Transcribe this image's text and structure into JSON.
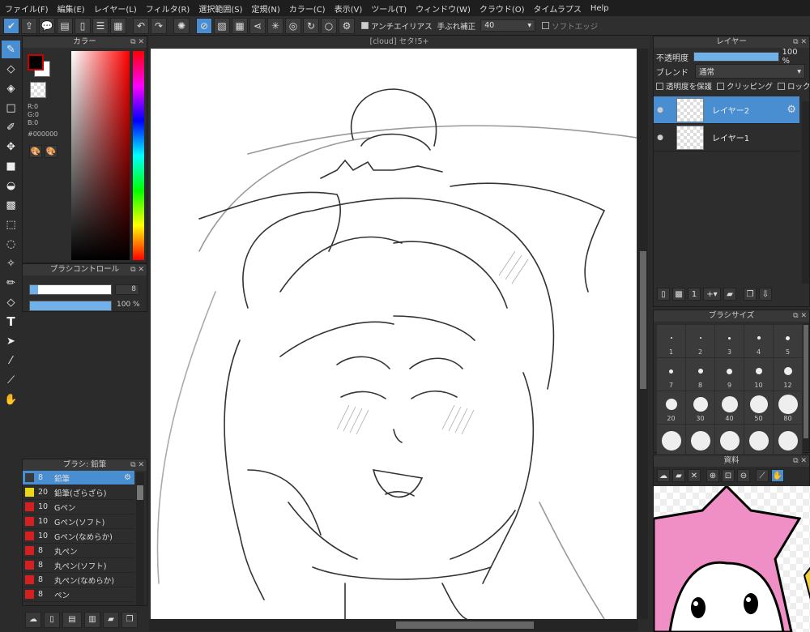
{
  "menu": [
    "ファイル(F)",
    "編集(E)",
    "レイヤー(L)",
    "フィルタ(R)",
    "選択範囲(S)",
    "定規(N)",
    "カラー(C)",
    "表示(V)",
    "ツール(T)",
    "ウィンドウ(W)",
    "クラウド(O)",
    "タイムラプス",
    "Help"
  ],
  "toolbar": {
    "antialias_label": "アンチエイリアス",
    "stabilizer_label": "手ぶれ補正",
    "stabilizer_value": "40",
    "softedge_label": "ソフトエッジ"
  },
  "color_panel": {
    "title": "カラー",
    "r": "R:0",
    "g": "G:0",
    "b": "B:0",
    "hex": "#000000",
    "primary_color": "#000000",
    "secondary_color": "#ffffff"
  },
  "brush_control": {
    "title": "ブラシコントロール",
    "size_value": "8",
    "opacity_value": "100 %",
    "size_fraction": 0.1,
    "opacity_fraction": 1.0
  },
  "brush_list": {
    "title": "ブラシ: 鉛筆",
    "items": [
      {
        "size": "8",
        "name": "鉛筆",
        "color": "#3a3a3a",
        "selected": true
      },
      {
        "size": "20",
        "name": "鉛筆(ざらざら)",
        "color": "#e8d818"
      },
      {
        "size": "10",
        "name": "Gペン",
        "color": "#d42020"
      },
      {
        "size": "10",
        "name": "Gペン(ソフト)",
        "color": "#d42020"
      },
      {
        "size": "10",
        "name": "Gペン(なめらか)",
        "color": "#d42020"
      },
      {
        "size": "8",
        "name": "丸ペン",
        "color": "#d42020"
      },
      {
        "size": "8",
        "name": "丸ペン(ソフト)",
        "color": "#d42020"
      },
      {
        "size": "8",
        "name": "丸ペン(なめらか)",
        "color": "#d42020"
      },
      {
        "size": "8",
        "name": "ペン",
        "color": "#d42020"
      }
    ]
  },
  "document": {
    "tab_title": "[cloud] セタ!5+"
  },
  "layer_panel": {
    "title": "レイヤー",
    "opacity_label": "不透明度",
    "opacity_value": "100 %",
    "blend_label": "ブレンド",
    "blend_value": "通常",
    "protect_label": "透明度を保護",
    "clipping_label": "クリッピング",
    "lock_label": "ロック",
    "layers": [
      {
        "name": "レイヤー2",
        "selected": true
      },
      {
        "name": "レイヤー1",
        "selected": false
      }
    ]
  },
  "brush_size_panel": {
    "title": "ブラシサイズ",
    "sizes": [
      "1",
      "2",
      "3",
      "4",
      "5",
      "7",
      "8",
      "9",
      "10",
      "12",
      "20",
      "30",
      "40",
      "50",
      "80",
      "",
      "",
      "",
      "",
      ""
    ]
  },
  "asset_panel": {
    "title": "資料"
  }
}
